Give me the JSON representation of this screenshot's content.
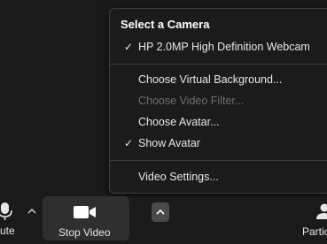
{
  "camera_menu": {
    "header": "Select a Camera",
    "camera": {
      "label": "HP 2.0MP High Definition Webcam",
      "checked": true
    },
    "items": [
      {
        "label": "Choose Virtual Background...",
        "disabled": false
      },
      {
        "label": "Choose Video Filter...",
        "disabled": true
      },
      {
        "label": "Choose Avatar...",
        "disabled": false
      },
      {
        "label": "Show Avatar",
        "checked": true,
        "disabled": false
      }
    ],
    "settings": {
      "label": "Video Settings..."
    },
    "checkmark": "✓"
  },
  "toolbar": {
    "mute_label": "ute",
    "stop_video_label": "Stop Video",
    "participants_label": "Partic",
    "icons": [
      "microphone-icon",
      "video-camera-icon",
      "participants-icon",
      "chevron-up-icon"
    ]
  },
  "colors": {
    "background": "#1a1a1a",
    "menu_background": "#1b1b1b",
    "text": "#e8e8e8",
    "disabled_text": "#6f6f6f",
    "button_active": "#2f2f2f"
  }
}
